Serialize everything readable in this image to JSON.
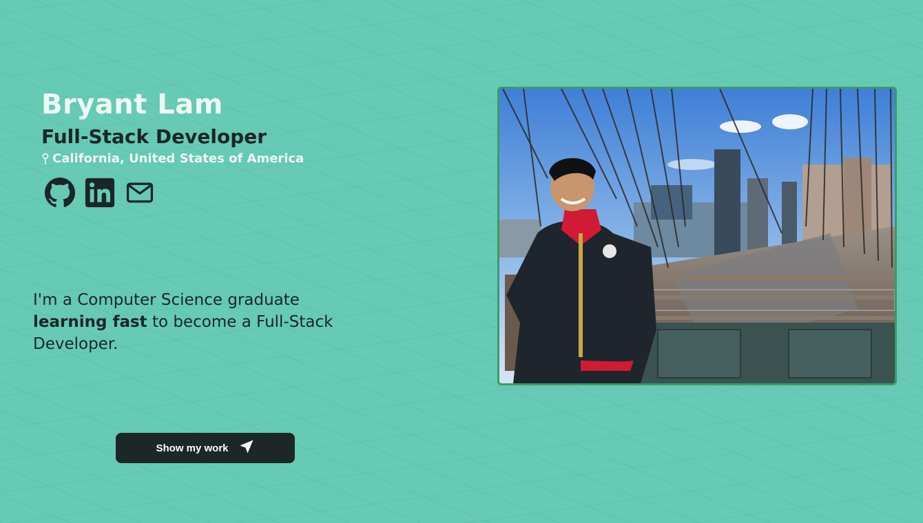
{
  "hero": {
    "name": "Bryant Lam",
    "role": "Full-Stack Developer",
    "location": "California, United States of America"
  },
  "socials": [
    {
      "icon": "github-icon"
    },
    {
      "icon": "linkedin-icon"
    },
    {
      "icon": "mail-icon"
    }
  ],
  "bio": {
    "intro": "I'm a Computer Science graduate",
    "highlight": "learning fast",
    "outro": " to become a Full-Stack Developer."
  },
  "cta": {
    "label": "Show my work",
    "icon": "send-icon"
  },
  "colors": {
    "background": "#66cab4",
    "text_dark": "#1b2626",
    "text_light": "#eef8f5",
    "button": "#1c2727",
    "photo_border": "#3c9a6a"
  }
}
